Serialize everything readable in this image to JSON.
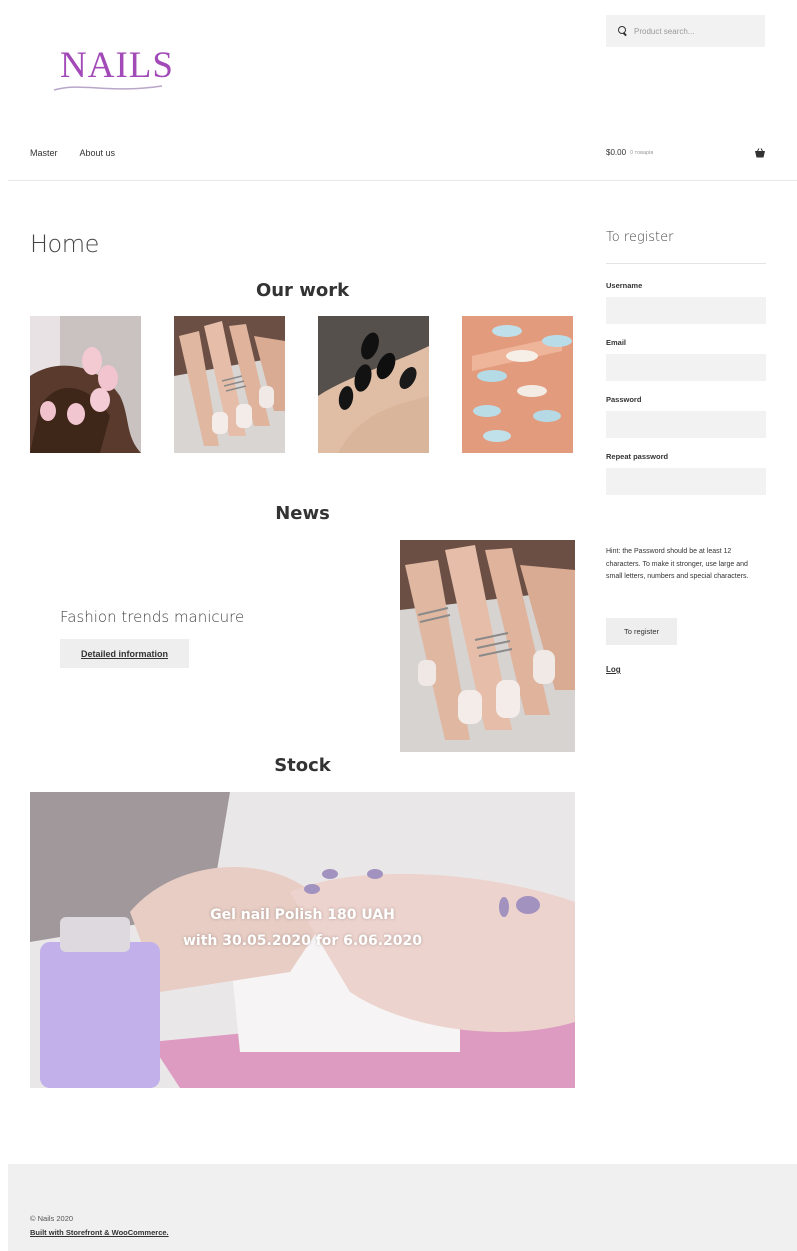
{
  "header": {
    "logo_text": "NAILS",
    "search_placeholder": "Product search...",
    "nav": [
      "Master",
      "About us"
    ],
    "cart_amount": "$0.00",
    "cart_count": "0 товарів"
  },
  "page_title": "Home",
  "our_work": {
    "title": "Our work",
    "images": [
      "pink-almond-nails-photo",
      "white-square-nails-with-rings-photo",
      "black-stiletto-nails-photo",
      "blue-white-nails-photo"
    ]
  },
  "news": {
    "title": "News",
    "item_title": "Fashion trends manicure",
    "button_label": "Detailed information",
    "image": "white-square-nails-with-rings-photo"
  },
  "stock": {
    "title": "Stock",
    "line1": "Gel nail Polish 180 UAH",
    "line2": "with 30.05.2020 for 6.06.2020",
    "image": "manicure-process-photo"
  },
  "register": {
    "title": "To register",
    "username_label": "Username",
    "email_label": "Email",
    "password_label": "Password",
    "repeat_password_label": "Repeat password",
    "hint": "Hint: the Password should be at least 12 characters. To make it stronger, use large and small letters, numbers and special characters.",
    "button_label": "To register",
    "login_link": "Log"
  },
  "footer": {
    "copyright": "© Nails 2020",
    "built_with": "Built with Storefront & WooCommerce."
  },
  "colors": {
    "brand": "#a24bb8",
    "light_grey": "#f2f2f2",
    "footer_bg": "#f0f0f0"
  }
}
